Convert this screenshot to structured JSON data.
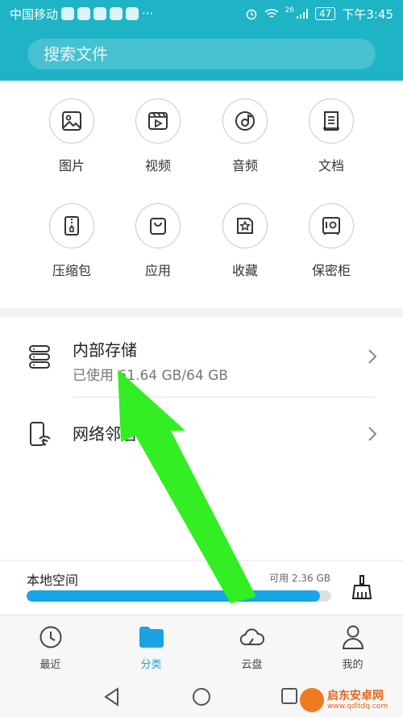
{
  "status_bar": {
    "carrier": "中国移动",
    "signal_badge": "26",
    "battery": "47",
    "time": "下午3:45",
    "more": "···"
  },
  "search": {
    "placeholder": "搜索文件"
  },
  "categories": [
    {
      "label": "图片",
      "icon": "image-icon"
    },
    {
      "label": "视频",
      "icon": "video-icon"
    },
    {
      "label": "音频",
      "icon": "audio-icon"
    },
    {
      "label": "文档",
      "icon": "document-icon"
    },
    {
      "label": "压缩包",
      "icon": "archive-icon"
    },
    {
      "label": "应用",
      "icon": "app-bag-icon"
    },
    {
      "label": "收藏",
      "icon": "star-icon"
    },
    {
      "label": "保密柜",
      "icon": "safe-icon"
    }
  ],
  "storage": {
    "internal_title": "内部存储",
    "internal_usage": "已使用 61.64 GB/64 GB",
    "network_title": "网络邻居"
  },
  "local_space": {
    "title": "本地空间",
    "available": "可用 2.36 GB",
    "used_fraction": 0.963
  },
  "tabs": [
    {
      "label": "最近",
      "icon": "clock-icon",
      "active": false
    },
    {
      "label": "分类",
      "icon": "folder-icon",
      "active": true
    },
    {
      "label": "云盘",
      "icon": "cloud-icon",
      "active": false
    },
    {
      "label": "我的",
      "icon": "person-icon",
      "active": false
    }
  ],
  "watermark": {
    "name": "启东安卓网",
    "url": "www.qdltdq.com"
  },
  "colors": {
    "header": "#1fb3c6",
    "accent_blue": "#1aa3e0",
    "arrow_green": "#33ee22"
  }
}
